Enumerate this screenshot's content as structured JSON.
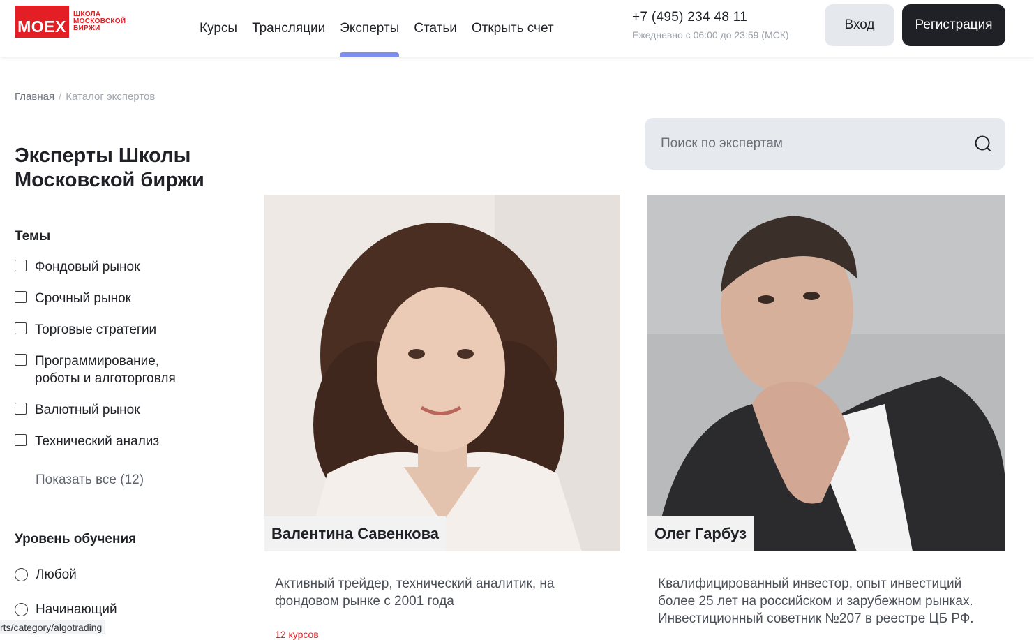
{
  "header": {
    "logo": {
      "wordmark": "MOEX",
      "line1": "ШКОЛА",
      "line2": "МОСКОВСКОЙ",
      "line3": "БИРЖИ"
    },
    "nav": [
      {
        "label": "Курсы",
        "active": false
      },
      {
        "label": "Трансляции",
        "active": false
      },
      {
        "label": "Эксперты",
        "active": true
      },
      {
        "label": "Статьи",
        "active": false
      },
      {
        "label": "Открыть счет",
        "active": false
      }
    ],
    "phone": "+7 (495) 234 48 11",
    "hours": "Ежедневно с 06:00 до 23:59 (МСК)",
    "login_label": "Вход",
    "register_label": "Регистрация"
  },
  "breadcrumb": {
    "home": "Главная",
    "separator": "/",
    "current": "Каталог экспертов"
  },
  "sidebar": {
    "title": "Эксперты Школы Московской биржи",
    "topics_title": "Темы",
    "topics": [
      {
        "label": "Фондовый рынок"
      },
      {
        "label": "Срочный рынок"
      },
      {
        "label": "Торговые стратегии"
      },
      {
        "label": "Программирование, роботы и алготорговля"
      },
      {
        "label": "Валютный рынок"
      },
      {
        "label": "Технический анализ"
      }
    ],
    "show_all": "Показать все (12)",
    "level_title": "Уровень обучения",
    "levels": [
      {
        "label": "Любой"
      },
      {
        "label": "Начинающий"
      }
    ]
  },
  "search": {
    "placeholder": "Поиск по экспертам"
  },
  "experts": [
    {
      "name": "Валентина Савенкова",
      "description": "Активный трейдер, технический аналитик, на фондовом рынке с 2001 года",
      "courses": "12 курсов"
    },
    {
      "name": "Олег Гарбуз",
      "description": "Квалифицированный инвестор, опыт инвестиций более 25 лет на российском и зарубежном рынках. Инвестиционный советник №207 в реестре ЦБ РФ."
    }
  ],
  "status_url": "rts/category/algotrading",
  "colors": {
    "brand_red": "#e31e24",
    "nav_active": "#7d8ef0",
    "dark_button": "#1f2126",
    "light_button": "#e5e8ec"
  }
}
